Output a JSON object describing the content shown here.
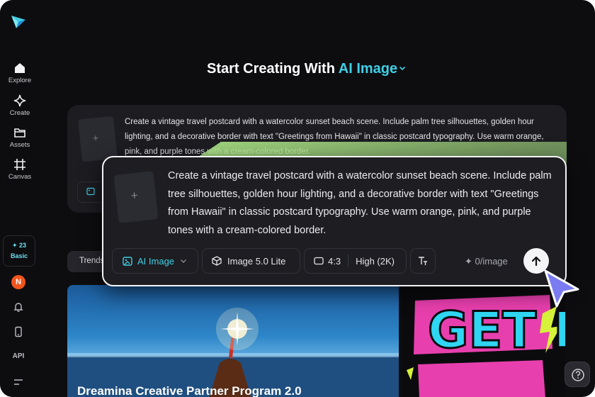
{
  "sidebar": {
    "items": [
      {
        "label": "Explore",
        "icon": "home-icon"
      },
      {
        "label": "Create",
        "icon": "sparkle-icon"
      },
      {
        "label": "Assets",
        "icon": "folder-icon"
      },
      {
        "label": "Canvas",
        "icon": "canvas-icon"
      }
    ],
    "credits": {
      "count": "23",
      "tier": "Basic"
    },
    "avatar_initial": "N",
    "api_label": "API"
  },
  "heading": {
    "prefix": "Start Creating With",
    "mode": "AI Image"
  },
  "prompt": {
    "text": "Create a vintage travel postcard with a watercolor sunset beach scene. Include palm tree silhouettes, golden hour lighting, and a decorative border with text \"Greetings from Hawaii\" in classic postcard typography. Use warm orange, pink, and purple tones with a cream-colored border."
  },
  "controls": {
    "model": "AI Image",
    "version": "Image 5.0 Lite",
    "ratio": "4:3",
    "quality": "High (2K)",
    "cost": "0/image"
  },
  "tabs": {
    "trends": "Trends"
  },
  "gallery": {
    "hero_title": "Dreamina Creative Partner Program 2.0",
    "poster_text": "GET FIT"
  },
  "colors": {
    "accent": "#3fd0e6",
    "background": "#0d0d10",
    "card": "#1c1c21",
    "avatar": "#f2551c",
    "cursor": "#7b7cf2",
    "beam": "#b4f08c"
  }
}
